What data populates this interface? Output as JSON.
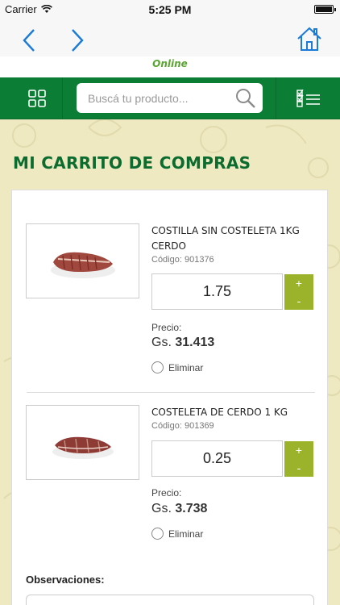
{
  "status_bar": {
    "carrier": "Carrier",
    "time": "5:25 PM"
  },
  "brand": {
    "logo_text": "Online",
    "primary_color": "#0c7d35",
    "accent_color": "#9ab32a"
  },
  "search": {
    "placeholder": "Buscá tu producto..."
  },
  "page": {
    "title": "MI CARRITO DE COMPRAS"
  },
  "items": [
    {
      "name": "COSTILLA SIN COSTELETA 1KG CERDO",
      "code": "Código: 901376",
      "quantity": "1.75",
      "plus_label": "+",
      "minus_label": "-",
      "price_label": "Precio:",
      "currency": "Gs.",
      "price": "31.413",
      "remove_label": "Eliminar"
    },
    {
      "name": "COSTELETA DE CERDO 1 KG",
      "code": "Código: 901369",
      "quantity": "0.25",
      "plus_label": "+",
      "minus_label": "-",
      "price_label": "Precio:",
      "currency": "Gs.",
      "price": "3.738",
      "remove_label": "Eliminar"
    }
  ],
  "observations": {
    "label": "Observaciones:"
  }
}
